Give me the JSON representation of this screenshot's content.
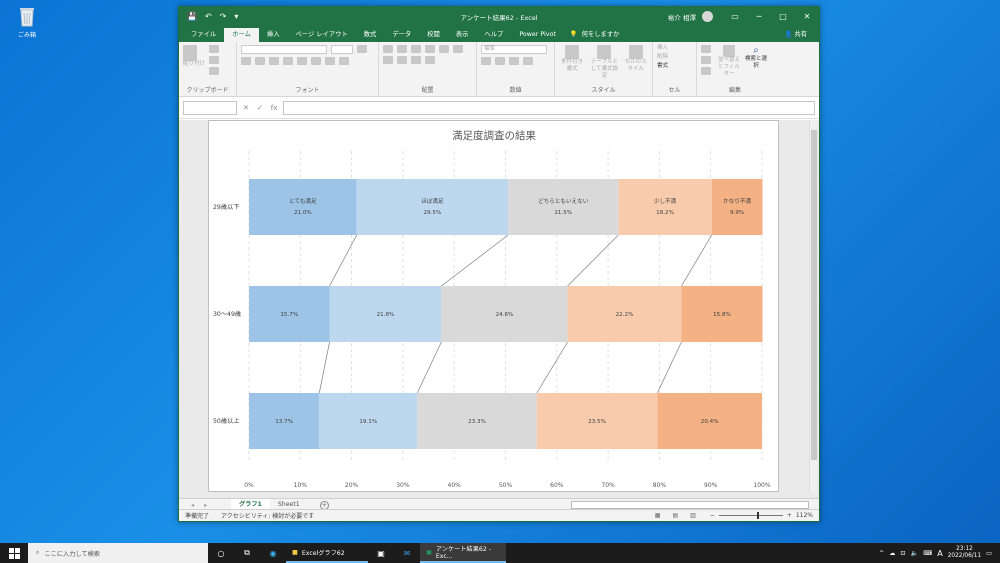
{
  "desktop": {
    "recycle_bin_label": "ごみ箱"
  },
  "window": {
    "title": "アンケート結果62 - Excel",
    "user_name": "裕介 相澤",
    "controls": {
      "minimize": "─",
      "maximize": "□",
      "close": "✕"
    },
    "qat": {
      "save": "💾",
      "undo": "↶",
      "redo": "↷",
      "customize": "▾"
    }
  },
  "ribbon_tabs": [
    "ファイル",
    "ホーム",
    "挿入",
    "ページ レイアウト",
    "数式",
    "データ",
    "校閲",
    "表示",
    "ヘルプ",
    "Power Pivot"
  ],
  "active_tab": "ホーム",
  "tell_me": "何をしますか",
  "share_label": "共有",
  "ribbon_groups": {
    "clipboard": "クリップボード",
    "font": "フォント",
    "alignment": "配置",
    "number": "数値",
    "styles": "スタイル",
    "cells": "セル",
    "editing": "編集"
  },
  "ribbon_texts": {
    "paste": "貼り付け",
    "number_format": "標準",
    "conditional_format": "条件付き書式",
    "format_as_table": "テーブルとして書式設定",
    "cell_styles": "セルのスタイル",
    "insert": "挿入",
    "delete": "削除",
    "format": "書式",
    "sort_filter": "並べ替えとフィルター",
    "find_select": "検索と選択"
  },
  "formula_bar": {
    "fx": "fx",
    "cancel": "✕",
    "enter": "✓"
  },
  "sheet_tabs": [
    "グラフ1",
    "Sheet1"
  ],
  "active_sheet": "グラフ1",
  "status": {
    "ready": "準備完了",
    "accessibility": "アクセシビリティ: 検討が必要です",
    "zoom": "112%"
  },
  "taskbar": {
    "search_placeholder": "ここに入力して検索",
    "apps": [
      {
        "label": "Excelグラフ62",
        "active": false
      },
      {
        "label": "アンケート結果62 - Exc...",
        "active": true
      }
    ],
    "ime": "A",
    "time": "23:12",
    "date": "2022/06/11"
  },
  "chart_data": {
    "type": "bar",
    "orientation": "horizontal-stacked-100",
    "title": "満足度調査の結果",
    "categories": [
      "29歳以下",
      "30～49歳",
      "50歳以上"
    ],
    "series": [
      {
        "name": "とても満足",
        "color": "#9dc3e6",
        "values": [
          21.0,
          15.7,
          13.7
        ]
      },
      {
        "name": "ほぼ満足",
        "color": "#bdd7ee",
        "values": [
          29.5,
          21.8,
          19.1
        ]
      },
      {
        "name": "どちらともいえない",
        "color": "#d9d9d9",
        "values": [
          21.5,
          24.6,
          23.3
        ]
      },
      {
        "name": "少し不満",
        "color": "#f8cbad",
        "values": [
          18.2,
          22.2,
          23.5
        ]
      },
      {
        "name": "かなり不満",
        "color": "#f4b183",
        "values": [
          9.9,
          15.8,
          20.4
        ]
      }
    ],
    "xlim": [
      0,
      100
    ],
    "xticks": [
      "0%",
      "10%",
      "20%",
      "30%",
      "40%",
      "50%",
      "60%",
      "70%",
      "80%",
      "90%",
      "100%"
    ],
    "grid": "vertical-dashed",
    "series_lines": true
  }
}
